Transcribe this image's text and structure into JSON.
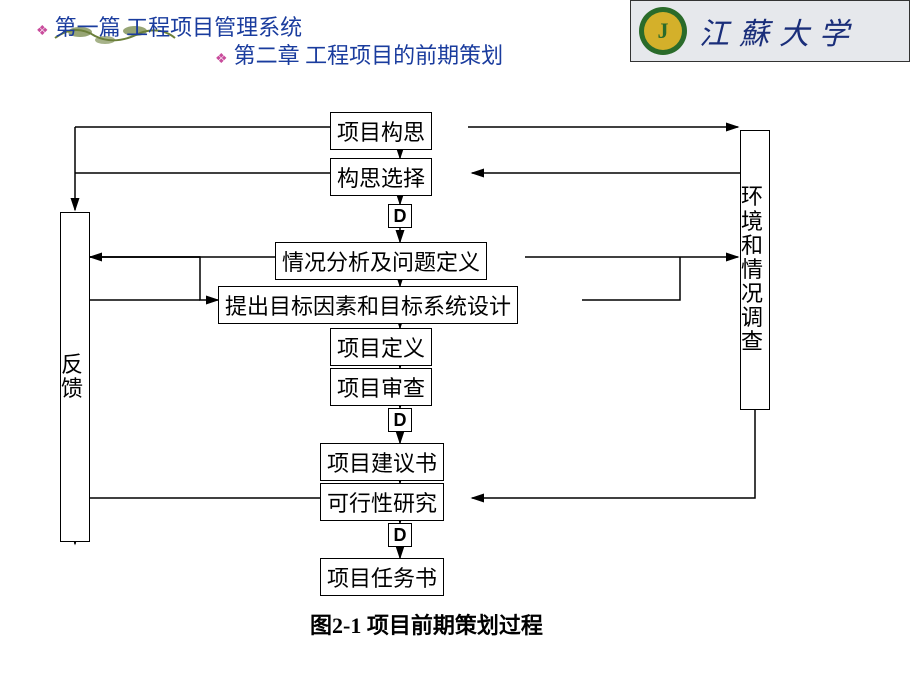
{
  "header": {
    "part": "第一篇  工程项目管理系统",
    "chapter": "第二章 工程项目的前期策划"
  },
  "university": {
    "initial": "J",
    "name": "江蘇大学"
  },
  "flowchart": {
    "left_box": "反馈",
    "right_box": "环境和情况调查",
    "nodes": {
      "n1": "项目构思",
      "n2": "构思选择",
      "d1": "D",
      "n3": "情况分析及问题定义",
      "n4": "提出目标因素和目标系统设计",
      "n5": "项目定义",
      "n6": "项目审查",
      "d2": "D",
      "n7": "项目建议书",
      "n8": "可行性研究",
      "d3": "D",
      "n9": "项目任务书"
    }
  },
  "caption": "图2-1   项目前期策划过程"
}
